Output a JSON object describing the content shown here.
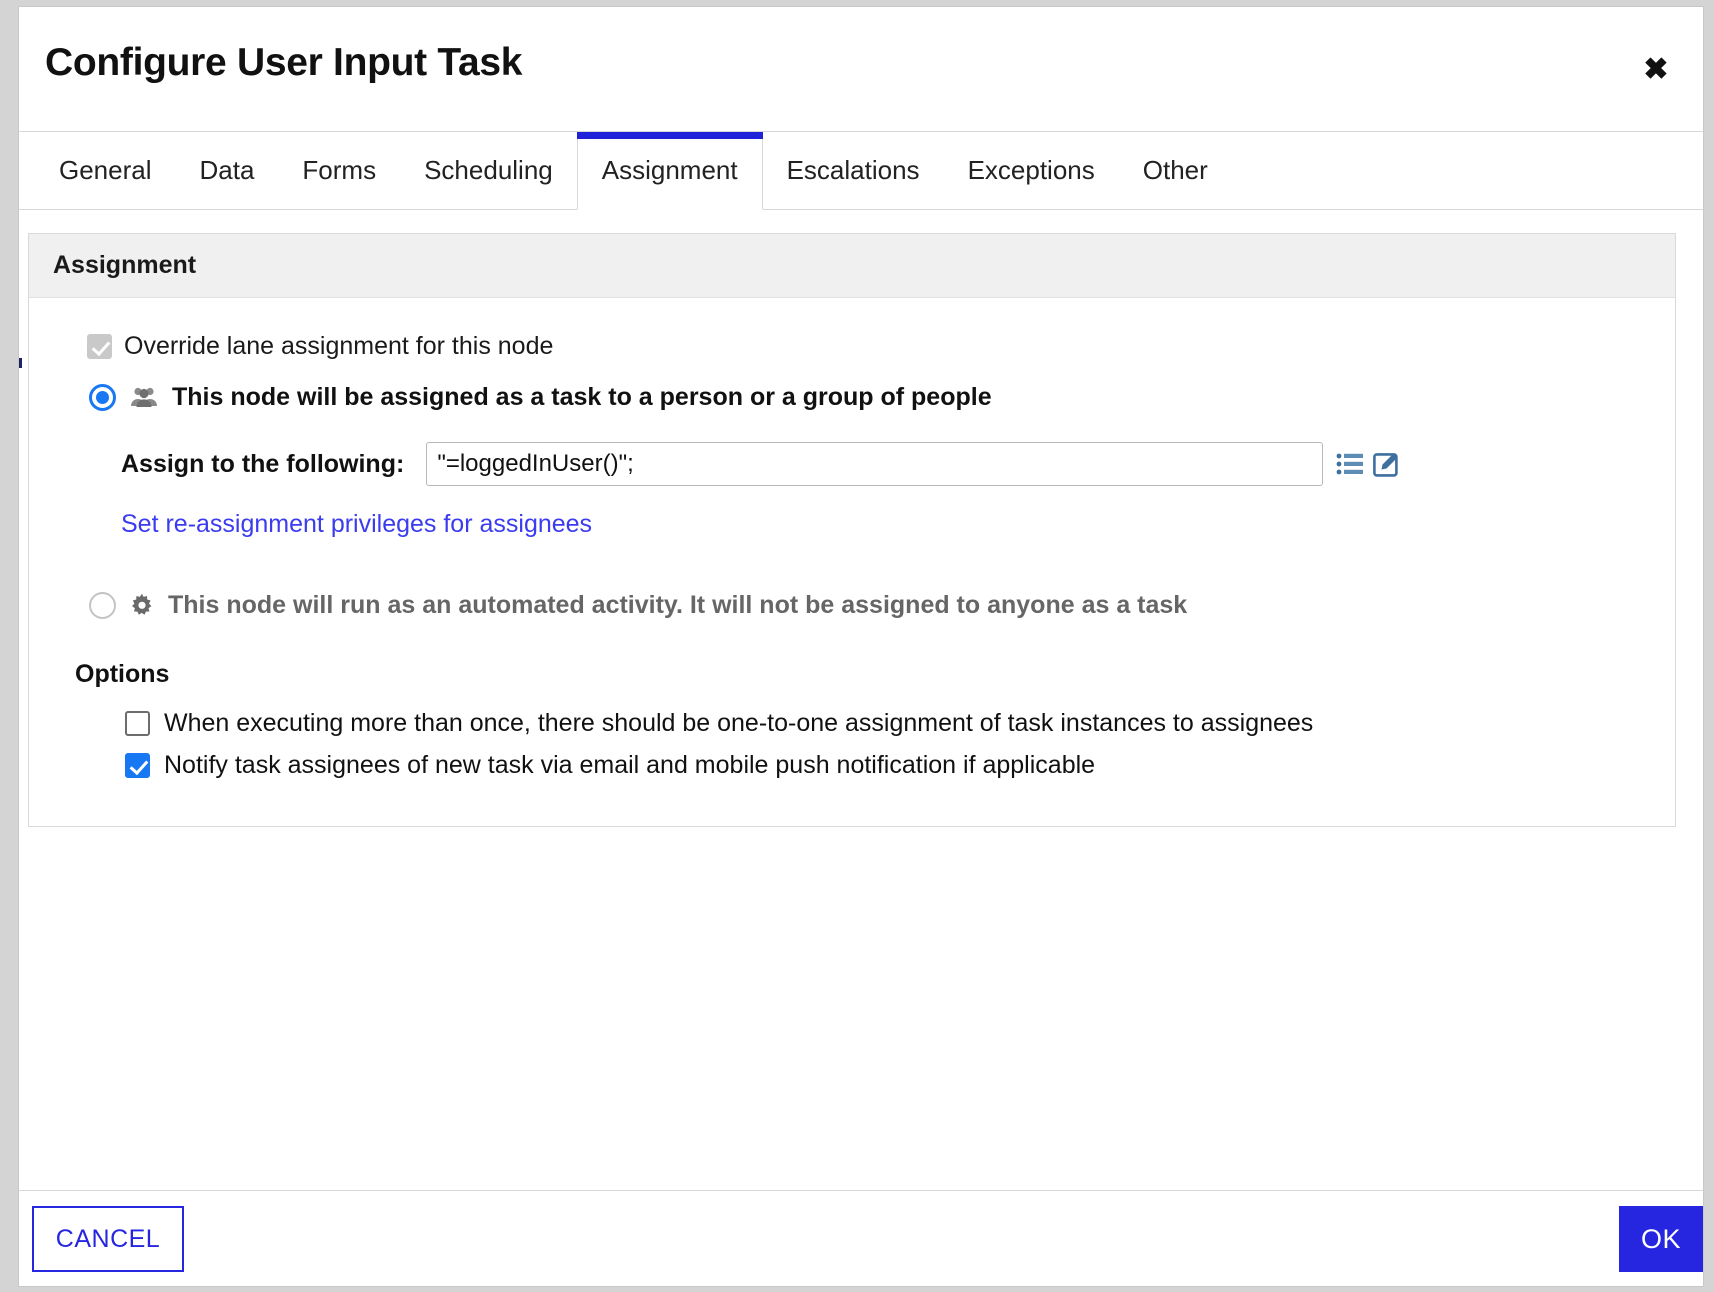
{
  "dialog": {
    "title": "Configure User Input Task",
    "close_icon": "close-icon"
  },
  "tabs": [
    {
      "label": "General",
      "active": false
    },
    {
      "label": "Data",
      "active": false
    },
    {
      "label": "Forms",
      "active": false
    },
    {
      "label": "Scheduling",
      "active": false
    },
    {
      "label": "Assignment",
      "active": true
    },
    {
      "label": "Escalations",
      "active": false
    },
    {
      "label": "Exceptions",
      "active": false
    },
    {
      "label": "Other",
      "active": false
    }
  ],
  "panel": {
    "header": "Assignment",
    "override_checkbox": {
      "label": "Override lane assignment for this node",
      "checked": true,
      "disabled": true
    },
    "radio_person": {
      "label": "This node will be assigned as a task to a person or a group of people",
      "icon": "people-group-icon",
      "selected": true
    },
    "assign": {
      "label": "Assign to the following:",
      "value": "\"=loggedInUser()\";",
      "placeholder": "",
      "list_icon": "list-icon",
      "edit_icon": "edit-pencil-icon"
    },
    "reassign_link": "Set re-assignment privileges for assignees",
    "radio_automated": {
      "label": "This node will run as an automated activity. It will not be assigned to anyone as a task",
      "icon": "gear-icon",
      "selected": false
    },
    "options": {
      "title": "Options",
      "items": [
        {
          "label": "When executing more than once, there should be one-to-one assignment of task instances to assignees",
          "checked": false
        },
        {
          "label": "Notify task assignees of new task via email and mobile push notification if applicable",
          "checked": true
        }
      ]
    }
  },
  "footer": {
    "cancel_label": "CANCEL",
    "ok_label": "OK"
  },
  "colors": {
    "accent": "#2626e0",
    "tab_active_bar": "#1f22d8",
    "link": "#3b3bf0",
    "checkbox_on": "#1878f3",
    "radio_on": "#1877f2",
    "panel_header_bg": "#f0f0f0",
    "icon_blue": "#4a7aa8"
  }
}
